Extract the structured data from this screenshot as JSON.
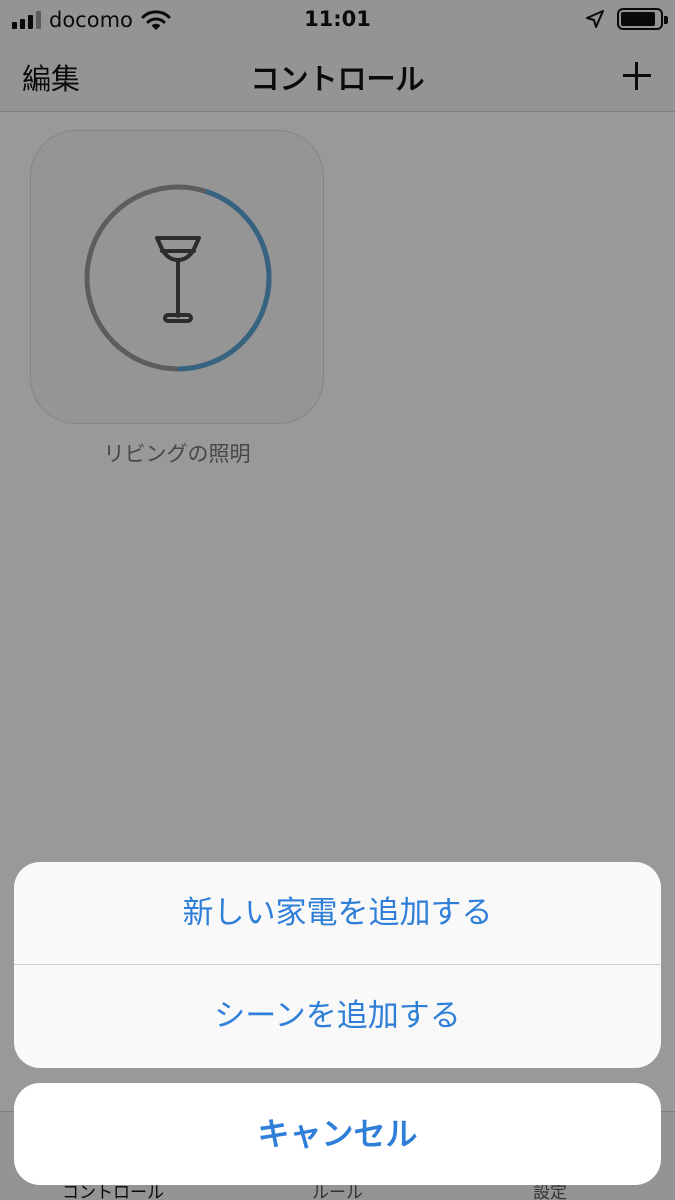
{
  "status_bar": {
    "carrier": "docomo",
    "time": "11:01",
    "icons": [
      "signal-icon",
      "wifi-icon",
      "location-arrow-icon",
      "battery-icon"
    ]
  },
  "nav": {
    "edit_label": "編集",
    "title": "コントロール",
    "add_icon": "plus-icon"
  },
  "controls": [
    {
      "label": "リビングの照明",
      "icon": "floor-lamp-icon",
      "brightness_level": 0.45
    }
  ],
  "tab_bar": {
    "tabs": [
      {
        "label": "コントロール",
        "selected": true
      },
      {
        "label": "ルール",
        "selected": false
      },
      {
        "label": "設定",
        "selected": false
      }
    ]
  },
  "action_sheet": {
    "actions": [
      {
        "label": "新しい家電を追加する"
      },
      {
        "label": "シーンを追加する"
      }
    ],
    "cancel_label": "キャンセル"
  },
  "colors": {
    "accent": "#2f7fd9",
    "dial_active": "#5aa6d6",
    "dial_track": "#9b9b9b"
  }
}
